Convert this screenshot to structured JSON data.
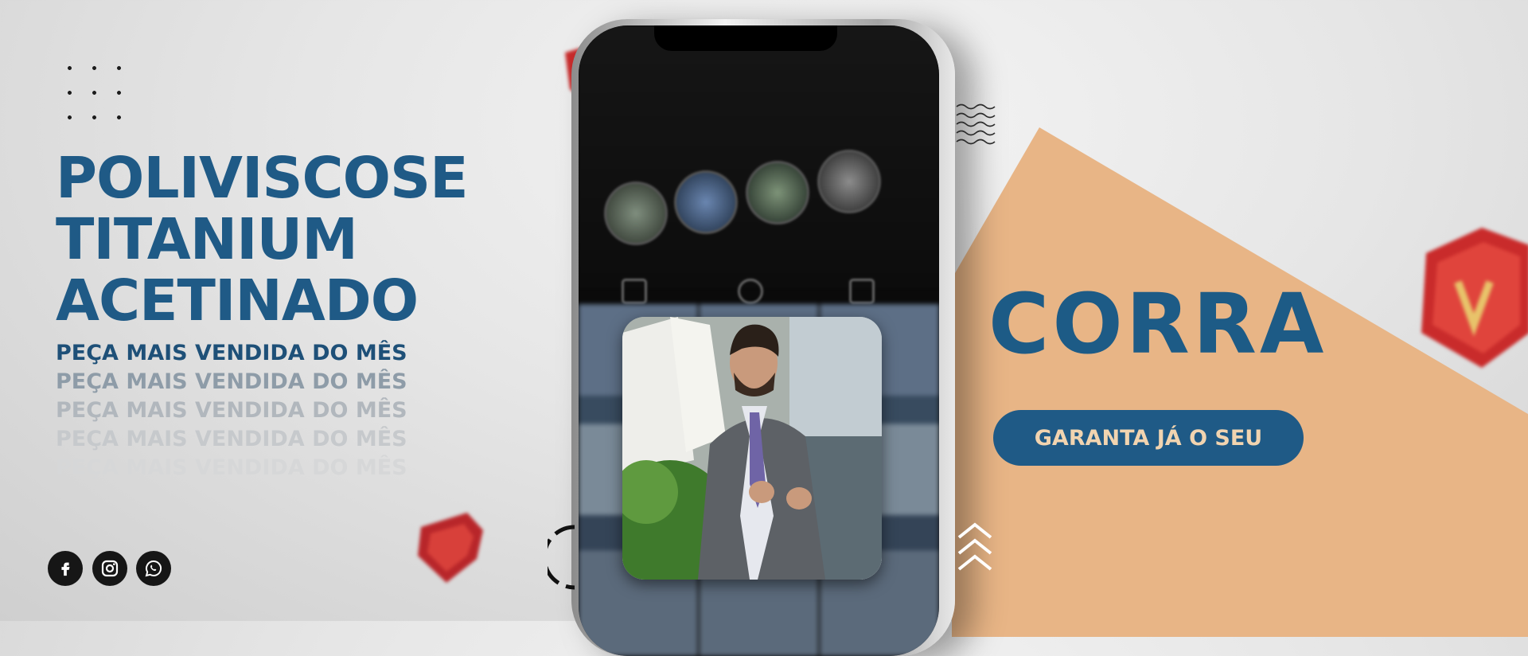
{
  "headline": {
    "line1": "POLIVISCOSE",
    "line2": "TITANIUM",
    "line3": "ACETINADO"
  },
  "subheadline": [
    "PEÇA MAIS VENDIDA DO MÊS",
    "PEÇA MAIS VENDIDA DO MÊS",
    "PEÇA MAIS VENDIDA DO MÊS",
    "PEÇA MAIS VENDIDA DO MÊS",
    "PEÇA MAIS VENDIDA DO MÊS"
  ],
  "cta": {
    "title": "CORRA",
    "button_label": "GARANTA JÁ O SEU"
  },
  "social": [
    "facebook-icon",
    "instagram-icon",
    "whatsapp-icon"
  ],
  "colors": {
    "brand_blue": "#1f5a86",
    "peach": "#e8b586",
    "shield_red": "#c92b2b"
  }
}
